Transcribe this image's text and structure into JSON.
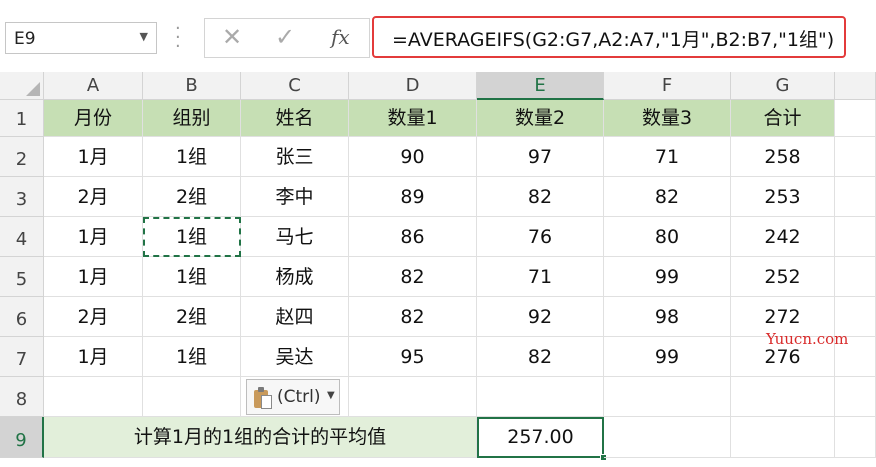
{
  "name_box": {
    "value": "E9"
  },
  "formula_bar": {
    "formula": "=AVERAGEIFS(G2:G7,A2:A7,\"1月\",B2:B7,\"1组\")",
    "fx_label": "fx"
  },
  "columns": [
    "A",
    "B",
    "C",
    "D",
    "E",
    "F",
    "G"
  ],
  "rows": [
    "1",
    "2",
    "3",
    "4",
    "5",
    "6",
    "7",
    "8",
    "9"
  ],
  "selected_column": "E",
  "selected_row": "9",
  "header_row": [
    "月份",
    "组别",
    "姓名",
    "数量1",
    "数量2",
    "数量3",
    "合计"
  ],
  "data_rows": [
    [
      "1月",
      "1组",
      "张三",
      "90",
      "97",
      "71",
      "258"
    ],
    [
      "2月",
      "2组",
      "李中",
      "89",
      "82",
      "82",
      "253"
    ],
    [
      "1月",
      "1组",
      "马七",
      "86",
      "76",
      "80",
      "242"
    ],
    [
      "1月",
      "1组",
      "杨成",
      "82",
      "71",
      "99",
      "252"
    ],
    [
      "2月",
      "2组",
      "赵四",
      "82",
      "92",
      "98",
      "272"
    ],
    [
      "1月",
      "1组",
      "吴达",
      "95",
      "82",
      "99",
      "276"
    ]
  ],
  "summary": {
    "label": "计算1月的1组的合计的平均值",
    "result": "257.00"
  },
  "paste_options": {
    "label": "(Ctrl)",
    "icon": "clipboard-icon"
  },
  "watermark": "Yuucn.com",
  "colors": {
    "header_fill": "#c6dfb4",
    "summary_fill": "#e2efda",
    "selection_green": "#217346",
    "formula_highlight": "#e33b3b",
    "watermark_red": "#d92a2a"
  }
}
